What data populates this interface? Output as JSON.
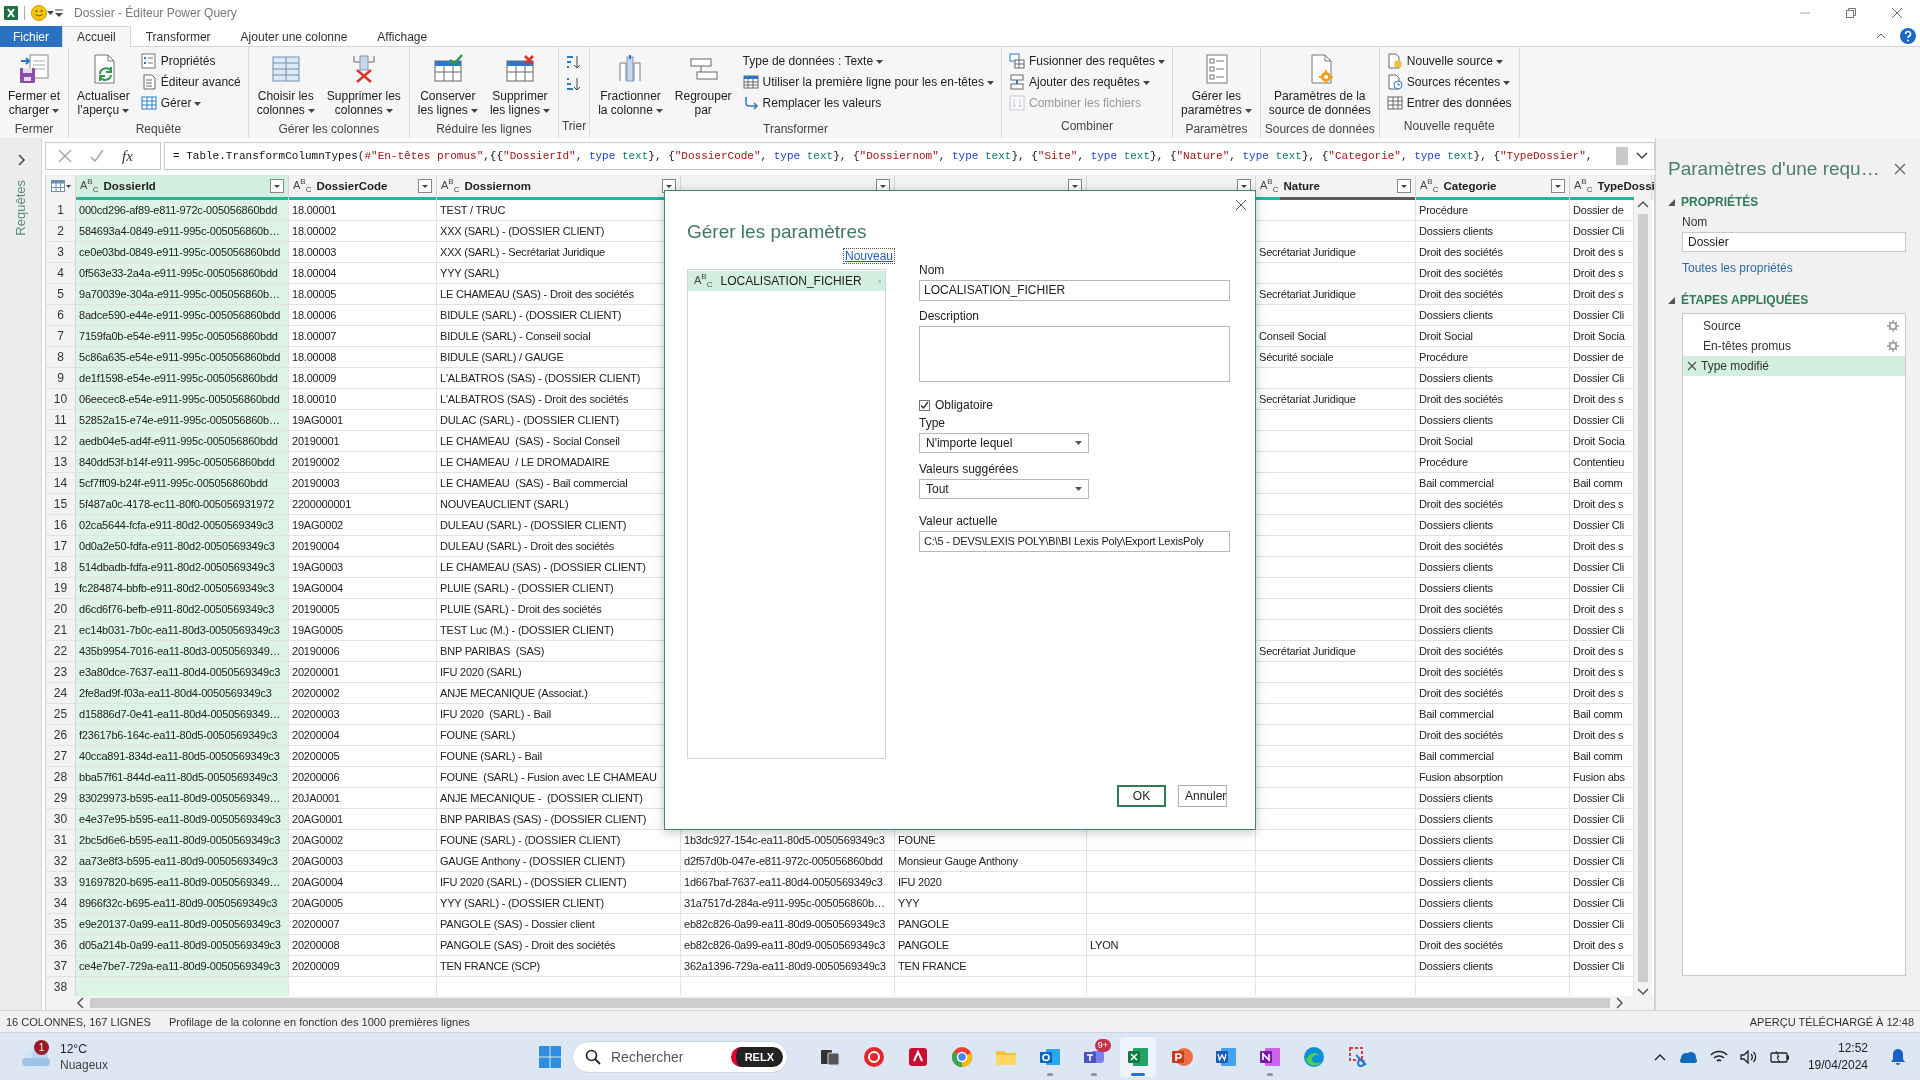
{
  "window": {
    "title": "Dossier - Éditeur Power Query"
  },
  "ribbon": {
    "tabs": [
      {
        "label": "Fichier",
        "kind": "file",
        "selected": false
      },
      {
        "label": "Accueil",
        "kind": "tab",
        "selected": true
      },
      {
        "label": "Transformer",
        "kind": "tab",
        "selected": false
      },
      {
        "label": "Ajouter une colonne",
        "kind": "tab",
        "selected": false
      },
      {
        "label": "Affichage",
        "kind": "tab",
        "selected": false
      }
    ],
    "groups": [
      {
        "label": "Fermer",
        "buttons": [
          {
            "kind": "large",
            "label": "Fermer et\ncharger",
            "dropdown": true,
            "disabled": false
          }
        ]
      },
      {
        "label": "Requête",
        "buttons": [
          {
            "kind": "large",
            "label": "Actualiser\nl'aperçu",
            "dropdown": true,
            "disabled": false
          },
          {
            "kind": "small",
            "label": "Propriétés",
            "dropdown": false,
            "disabled": false
          },
          {
            "kind": "small",
            "label": "Éditeur avancé",
            "dropdown": false,
            "disabled": false
          },
          {
            "kind": "small",
            "label": "Gérer",
            "dropdown": true,
            "disabled": false
          }
        ]
      },
      {
        "label": "Gérer les colonnes",
        "buttons": [
          {
            "kind": "large",
            "label": "Choisir les\ncolonnes",
            "dropdown": true,
            "disabled": false
          },
          {
            "kind": "large",
            "label": "Supprimer les\ncolonnes",
            "dropdown": true,
            "disabled": false
          }
        ]
      },
      {
        "label": "Réduire les lignes",
        "buttons": [
          {
            "kind": "large",
            "label": "Conserver\nles lignes",
            "dropdown": true,
            "disabled": false
          },
          {
            "kind": "large",
            "label": "Supprimer\nles lignes",
            "dropdown": true,
            "disabled": false
          }
        ]
      },
      {
        "label": "Trier",
        "buttons": [
          {
            "kind": "icon",
            "dropdown": false,
            "disabled": false
          },
          {
            "kind": "icon",
            "dropdown": false,
            "disabled": false
          }
        ]
      },
      {
        "label": "Transformer",
        "buttons": [
          {
            "kind": "large",
            "label": "Fractionner\nla colonne",
            "dropdown": true,
            "disabled": false
          },
          {
            "kind": "large",
            "label": "Regrouper\npar",
            "dropdown": false,
            "disabled": false
          },
          {
            "kind": "small",
            "label": "Type de données : Texte",
            "dropdown": true,
            "disabled": false
          },
          {
            "kind": "small",
            "label": "Utiliser la première ligne pour les en-têtes",
            "dropdown": true,
            "disabled": false
          },
          {
            "kind": "small",
            "label": "Remplacer les valeurs",
            "dropdown": false,
            "disabled": false
          }
        ]
      },
      {
        "label": "Combiner",
        "buttons": [
          {
            "kind": "small",
            "label": "Fusionner des requêtes",
            "dropdown": true,
            "disabled": false
          },
          {
            "kind": "small",
            "label": "Ajouter des requêtes",
            "dropdown": true,
            "disabled": false
          },
          {
            "kind": "small",
            "label": "Combiner les fichiers",
            "dropdown": false,
            "disabled": true
          }
        ]
      },
      {
        "label": "Paramètres",
        "buttons": [
          {
            "kind": "large",
            "label": "Gérer les\nparamètres",
            "dropdown": true,
            "disabled": false
          }
        ]
      },
      {
        "label": "Sources de données",
        "buttons": [
          {
            "kind": "large",
            "label": "Paramètres de la\nsource de données",
            "dropdown": false,
            "disabled": false
          }
        ]
      },
      {
        "label": "Nouvelle requête",
        "buttons": [
          {
            "kind": "small",
            "label": "Nouvelle source",
            "dropdown": true,
            "disabled": false
          },
          {
            "kind": "small",
            "label": "Sources récentes",
            "dropdown": true,
            "disabled": false
          },
          {
            "kind": "small",
            "label": "Entrer des données",
            "dropdown": false,
            "disabled": false
          }
        ]
      }
    ]
  },
  "queries_pane": {
    "label": "Requêtes",
    "expanded": false
  },
  "formula_bar": {
    "fx": "fx",
    "segments": [
      {
        "kind": "plain",
        "text": "= Table.TransformColumnTypes("
      },
      {
        "kind": "string",
        "text": "#\"En-têtes promus\""
      },
      {
        "kind": "plain",
        "text": ",{{"
      },
      {
        "kind": "string",
        "text": "\"DossierId\""
      },
      {
        "kind": "plain",
        "text": ", "
      },
      {
        "kind": "keyword",
        "text": "type"
      },
      {
        "kind": "type",
        "text": " text"
      },
      {
        "kind": "plain",
        "text": "}, {"
      },
      {
        "kind": "string",
        "text": "\"DossierCode\""
      },
      {
        "kind": "plain",
        "text": ", "
      },
      {
        "kind": "keyword",
        "text": "type"
      },
      {
        "kind": "type",
        "text": " text"
      },
      {
        "kind": "plain",
        "text": "}, {"
      },
      {
        "kind": "string",
        "text": "\"Dossiernom\""
      },
      {
        "kind": "plain",
        "text": ", "
      },
      {
        "kind": "keyword",
        "text": "type"
      },
      {
        "kind": "type",
        "text": " text"
      },
      {
        "kind": "plain",
        "text": "}, {"
      },
      {
        "kind": "string",
        "text": "\"Site\""
      },
      {
        "kind": "plain",
        "text": ", "
      },
      {
        "kind": "keyword",
        "text": "type"
      },
      {
        "kind": "type",
        "text": " text"
      },
      {
        "kind": "plain",
        "text": "}, {"
      },
      {
        "kind": "string",
        "text": "\"Nature\""
      },
      {
        "kind": "plain",
        "text": ", "
      },
      {
        "kind": "keyword",
        "text": "type"
      },
      {
        "kind": "type",
        "text": " text"
      },
      {
        "kind": "plain",
        "text": "}, {"
      },
      {
        "kind": "string",
        "text": "\"Categorie\""
      },
      {
        "kind": "plain",
        "text": ", "
      },
      {
        "kind": "keyword",
        "text": "type"
      },
      {
        "kind": "type",
        "text": " text"
      },
      {
        "kind": "plain",
        "text": "}, {"
      },
      {
        "kind": "string",
        "text": "\"TypeDossier\""
      },
      {
        "kind": "plain",
        "text": ","
      }
    ]
  },
  "table": {
    "columns": [
      {
        "label": "DossierId",
        "type_icon": "A$^{B}$$_{C}$",
        "filter": true,
        "selected": true,
        "level": 1
      },
      {
        "label": "DossierCode",
        "type_icon": "A$^{B}$$_{C}$",
        "filter": true,
        "selected": false,
        "level": 1
      },
      {
        "label": "Dossiernom",
        "type_icon": "A$^{B}$$_{C}$",
        "filter": true,
        "selected": false,
        "level": 1
      },
      {
        "filter": true,
        "selected": false
      },
      {
        "filter": true,
        "selected": false
      },
      {
        "filter": true,
        "selected": false
      },
      {
        "label": "Nature",
        "type_icon": "A$^{B}$$_{C}$",
        "filter": true,
        "selected": false,
        "level": 0.15
      },
      {
        "label": "Categorie",
        "type_icon": "A$^{B}$$_{C}$",
        "filter": true,
        "selected": false,
        "level": 1
      },
      {
        "label": "TypeDossi",
        "type_icon": "A$^{B}$$_{C}$",
        "filter": false,
        "selected": false,
        "level": 1
      }
    ],
    "rows": [
      {
        "number": "1",
        "dossier_id": "000cd296-af89-e811-972c-005056860bdd",
        "dossier_code": "18.00001",
        "dossiernom": "TEST / TRUC",
        "categorie": "Procédure",
        "type_dossier": "Dossier de"
      },
      {
        "number": "2",
        "dossier_id": "584693a4-0849-e911-995c-005056860b…",
        "dossier_code": "18.00002",
        "dossiernom": "XXX (SARL) - (DOSSIER CLIENT)",
        "categorie": "Dossiers clients",
        "type_dossier": "Dossier Cli"
      },
      {
        "number": "3",
        "dossier_id": "ce0e03bd-0849-e911-995c-005056860bdd",
        "dossier_code": "18.00003",
        "dossiernom": "XXX (SARL) - Secrétariat Juridique",
        "nature": "Secrétariat Juridique",
        "categorie": "Droit des sociétés",
        "type_dossier": "Droit des s"
      },
      {
        "number": "4",
        "dossier_id": "0f563e33-2a4a-e911-995c-005056860bdd",
        "dossier_code": "18.00004",
        "dossiernom": "YYY (SARL)",
        "categorie": "Droit des sociétés",
        "type_dossier": "Droit des s"
      },
      {
        "number": "5",
        "dossier_id": "9a70039e-304a-e911-995c-005056860b…",
        "dossier_code": "18.00005",
        "dossiernom": "LE CHAMEAU (SAS) - Droit des sociétés",
        "nature": "Secrétariat Juridique",
        "categorie": "Droit des sociétés",
        "type_dossier": "Droit des s"
      },
      {
        "number": "6",
        "dossier_id": "8adce590-e44e-e911-995c-005056860bdd",
        "dossier_code": "18.00006",
        "dossiernom": "BIDULE (SARL) - (DOSSIER CLIENT)",
        "categorie": "Dossiers clients",
        "type_dossier": "Dossier Cli"
      },
      {
        "number": "7",
        "dossier_id": "7159fa0b-e54e-e911-995c-005056860bdd",
        "dossier_code": "18.00007",
        "dossiernom": "BIDULE (SARL) - Conseil social",
        "nature": "Conseil Social",
        "categorie": "Droit Social",
        "type_dossier": "Droit Socia"
      },
      {
        "number": "8",
        "dossier_id": "5c86a635-e54e-e911-995c-005056860bdd",
        "dossier_code": "18.00008",
        "dossiernom": "BIDULE (SARL) / GAUGE",
        "nature": "Sécurité sociale",
        "categorie": "Procédure",
        "type_dossier": "Dossier de"
      },
      {
        "number": "9",
        "dossier_id": "de1f1598-e54e-e911-995c-005056860bdd",
        "dossier_code": "18.00009",
        "dossiernom": "L'ALBATROS (SAS) - (DOSSIER CLIENT)",
        "categorie": "Dossiers clients",
        "type_dossier": "Dossier Cli"
      },
      {
        "number": "10",
        "dossier_id": "06eecec8-e54e-e911-995c-005056860bdd",
        "dossier_code": "18.00010",
        "dossiernom": "L'ALBATROS (SAS) - Droit des sociétés",
        "nature": "Secrétariat Juridique",
        "categorie": "Droit des sociétés",
        "type_dossier": "Droit des s"
      },
      {
        "number": "11",
        "dossier_id": "52852a15-e74e-e911-995c-005056860b…",
        "dossier_code": "19AG0001",
        "dossiernom": "DULAC (SARL) - (DOSSIER CLIENT)",
        "categorie": "Dossiers clients",
        "type_dossier": "Dossier Cli"
      },
      {
        "number": "12",
        "dossier_id": "aedb04e5-ad4f-e911-995c-005056860bdd",
        "dossier_code": "20190001",
        "dossiernom": "LE CHAMEAU  (SAS) - Social Conseil",
        "categorie": "Droit Social",
        "type_dossier": "Droit Socia"
      },
      {
        "number": "13",
        "dossier_id": "840dd53f-b14f-e911-995c-005056860bdd",
        "dossier_code": "20190002",
        "dossiernom": "LE CHAMEAU  / LE DROMADAIRE",
        "categorie": "Procédure",
        "type_dossier": "Contentieu"
      },
      {
        "number": "14",
        "dossier_id": "5cf7ff09-b24f-e911-995c-005056860bdd",
        "dossier_code": "20190003",
        "dossiernom": "LE CHAMEAU  (SAS) - Bail commercial",
        "categorie": "Bail commercial",
        "type_dossier": "Bail comm"
      },
      {
        "number": "15",
        "dossier_id": "5f487a0c-4178-ec11-80f0-005056931972",
        "dossier_code": "2200000001",
        "dossiernom": "NOUVEAUCLIENT (SARL)",
        "categorie": "Droit des sociétés",
        "type_dossier": "Droit des s"
      },
      {
        "number": "16",
        "dossier_id": "02ca5644-fcfa-e911-80d2-0050569349c3",
        "dossier_code": "19AG0002",
        "dossiernom": "DULEAU (SARL) - (DOSSIER CLIENT)",
        "categorie": "Dossiers clients",
        "type_dossier": "Dossier Cli"
      },
      {
        "number": "17",
        "dossier_id": "0d0a2e50-fdfa-e911-80d2-0050569349c3",
        "dossier_code": "20190004",
        "dossiernom": "DULEAU (SARL) - Droit des sociétés",
        "categorie": "Droit des sociétés",
        "type_dossier": "Droit des s"
      },
      {
        "number": "18",
        "dossier_id": "514dbadb-fdfa-e911-80d2-0050569349c3",
        "dossier_code": "19AG0003",
        "dossiernom": "LE CHAMEAU (SAS) - (DOSSIER CLIENT)",
        "categorie": "Dossiers clients",
        "type_dossier": "Dossier Cli"
      },
      {
        "number": "19",
        "dossier_id": "fc284874-bbfb-e911-80d2-0050569349c3",
        "dossier_code": "19AG0004",
        "dossiernom": "PLUIE (SARL) - (DOSSIER CLIENT)",
        "categorie": "Dossiers clients",
        "type_dossier": "Dossier Cli"
      },
      {
        "number": "20",
        "dossier_id": "d6cd6f76-befb-e911-80d2-0050569349c3",
        "dossier_code": "20190005",
        "dossiernom": "PLUIE (SARL) - Droit des sociétés",
        "categorie": "Droit des sociétés",
        "type_dossier": "Droit des s"
      },
      {
        "number": "21",
        "dossier_id": "ec14b031-7b0c-ea11-80d3-0050569349c3",
        "dossier_code": "19AG0005",
        "dossiernom": "TEST Luc (M.) - (DOSSIER CLIENT)",
        "categorie": "Dossiers clients",
        "type_dossier": "Dossier Cli"
      },
      {
        "number": "22",
        "dossier_id": "435b9954-7016-ea11-80d3-0050569349…",
        "dossier_code": "20190006",
        "dossiernom": "BNP PARIBAS  (SAS)",
        "nature": "Secrétariat Juridique",
        "categorie": "Droit des sociétés",
        "type_dossier": "Droit des s"
      },
      {
        "number": "23",
        "dossier_id": "e3a80dce-7637-ea11-80d4-0050569349c3",
        "dossier_code": "20200001",
        "dossiernom": "IFU 2020 (SARL)",
        "categorie": "Droit des sociétés",
        "type_dossier": "Droit des s"
      },
      {
        "number": "24",
        "dossier_id": "2fe8ad9f-f03a-ea11-80d4-0050569349c3",
        "dossier_code": "20200002",
        "dossiernom": "ANJE MECANIQUE (Associat.)",
        "categorie": "Droit des sociétés",
        "type_dossier": "Droit des s"
      },
      {
        "number": "25",
        "dossier_id": "d15886d7-0e41-ea11-80d4-0050569349…",
        "dossier_code": "20200003",
        "dossiernom": "IFU 2020  (SARL) - Bail",
        "categorie": "Bail commercial",
        "type_dossier": "Bail comm"
      },
      {
        "number": "26",
        "dossier_id": "f23617b6-164c-ea11-80d5-0050569349c3",
        "dossier_code": "20200004",
        "dossiernom": "FOUNE (SARL)",
        "categorie": "Droit des sociétés",
        "type_dossier": "Droit des s"
      },
      {
        "number": "27",
        "dossier_id": "40cca891-834d-ea11-80d5-0050569349c3",
        "dossier_code": "20200005",
        "dossiernom": "FOUNE (SARL) - Bail",
        "categorie": "Bail commercial",
        "type_dossier": "Bail comm"
      },
      {
        "number": "28",
        "dossier_id": "bba57f61-844d-ea11-80d5-0050569349c3",
        "dossier_code": "20200006",
        "dossiernom": "FOUNE  (SARL) - Fusion avec LE CHAMEAU",
        "categorie": "Fusion absorption",
        "type_dossier": "Fusion abs"
      },
      {
        "number": "29",
        "dossier_id": "83029973-b595-ea11-80d9-0050569349…",
        "dossier_code": "20JA0001",
        "dossiernom": "ANJE MECANIQUE -  (DOSSIER CLIENT)",
        "categorie": "Dossiers clients",
        "type_dossier": "Dossier Cli"
      },
      {
        "number": "30",
        "dossier_id": "e4e37e95-b595-ea11-80d9-0050569349c3",
        "dossier_code": "20AG0001",
        "dossiernom": "BNP PARIBAS (SAS) - (DOSSIER CLIENT)",
        "categorie": "Dossiers clients",
        "type_dossier": "Dossier Cli"
      },
      {
        "number": "31",
        "dossier_id": "2bc5d6e6-b595-ea11-80d9-0050569349c3",
        "dossier_code": "20AG0002",
        "dossiernom": "FOUNE (SARL) - (DOSSIER CLIENT)",
        "column_4": "1b3dc927-154c-ea11-80d5-0050569349c3",
        "column_5": "FOUNE",
        "categorie": "Dossiers clients",
        "type_dossier": "Dossier Cli"
      },
      {
        "number": "32",
        "dossier_id": "aa73e8f3-b595-ea11-80d9-0050569349c3",
        "dossier_code": "20AG0003",
        "dossiernom": "GAUGE Anthony - (DOSSIER CLIENT)",
        "column_4": "d2f57d0b-047e-e811-972c-005056860bdd",
        "column_5": "Monsieur Gauge Anthony",
        "categorie": "Dossiers clients",
        "type_dossier": "Dossier Cli"
      },
      {
        "number": "33",
        "dossier_id": "91697820-b695-ea11-80d9-0050569349…",
        "dossier_code": "20AG0004",
        "dossiernom": "IFU 2020 (SARL) - (DOSSIER CLIENT)",
        "column_4": "1d667baf-7637-ea11-80d4-0050569349c3",
        "column_5": "IFU 2020",
        "categorie": "Dossiers clients",
        "type_dossier": "Dossier Cli"
      },
      {
        "number": "34",
        "dossier_id": "8966f32c-b695-ea11-80d9-0050569349c3",
        "dossier_code": "20AG0005",
        "dossiernom": "YYY (SARL) - (DOSSIER CLIENT)",
        "column_4": "31a7517d-284a-e911-995c-005056860b…",
        "column_5": "YYY",
        "categorie": "Dossiers clients",
        "type_dossier": "Dossier Cli"
      },
      {
        "number": "35",
        "dossier_id": "e9e20137-0a99-ea11-80d9-0050569349c3",
        "dossier_code": "20200007",
        "dossiernom": "PANGOLE (SAS) - Dossier client",
        "column_4": "eb82c826-0a99-ea11-80d9-0050569349c3",
        "column_5": "PANGOLE",
        "categorie": "Dossiers clients",
        "type_dossier": "Dossier Cli"
      },
      {
        "number": "36",
        "dossier_id": "d05a214b-0a99-ea11-80d9-0050569349c3",
        "dossier_code": "20200008",
        "dossiernom": "PANGOLE (SAS) - Droit des sociétés",
        "column_4": "eb82c826-0a99-ea11-80d9-0050569349c3",
        "column_5": "PANGOLE",
        "column_6": "LYON",
        "categorie": "Droit des sociétés",
        "type_dossier": "Droit des s"
      },
      {
        "number": "37",
        "dossier_id": "ce4e7be7-729a-ea11-80d9-0050569349c3",
        "dossier_code": "20200009",
        "dossiernom": "TEN FRANCE (SCP)",
        "column_4": "362a1396-729a-ea11-80d9-0050569349c3",
        "column_5": "TEN FRANCE",
        "categorie": "Dossiers clients",
        "type_dossier": "Dossier Cli"
      },
      {
        "number": "38"
      }
    ]
  },
  "dialog": {
    "title": "Gérer les paramètres",
    "new_link": "Nouveau",
    "parameters": [
      {
        "type_icon": "A$^{B}$$_{C}$",
        "name": "LOCALISATION_FICHIER",
        "selected": true
      }
    ],
    "name_label": "Nom",
    "name_value": "LOCALISATION_FICHIER",
    "description_label": "Description",
    "required": {
      "label": "Obligatoire",
      "checked": true
    },
    "type_label": "Type",
    "type_value": "N'importe lequel",
    "suggested_label": "Valeurs suggérées",
    "suggested_value": "Tout",
    "current_label": "Valeur actuelle",
    "current_value": "C:\\5 - DEVS\\LEXIS POLY\\BI\\BI Lexis Poly\\Export LexisPoly",
    "buttons": [
      {
        "label": "OK",
        "kind": "primary"
      },
      {
        "label": "Annuler",
        "kind": "secondary"
      }
    ]
  },
  "query_settings": {
    "title": "Paramètres d'une requ…",
    "properties": {
      "heading": "PROPRIÉTÉS",
      "expanded": true,
      "name_label": "Nom",
      "name_value": "Dossier",
      "link": "Toutes les propriétés"
    },
    "steps": {
      "heading": "ÉTAPES APPLIQUÉES",
      "expanded": true,
      "items": [
        {
          "label": "Source",
          "selected": false,
          "has_settings": true
        },
        {
          "label": "En-têtes promus",
          "selected": false,
          "has_settings": true
        },
        {
          "label": "Type modifié",
          "selected": true,
          "has_settings": false
        }
      ]
    }
  },
  "status_bar": {
    "left": [
      "16 COLONNES, 167 LIGNES",
      "Profilage de la colonne en fonction des 1000 premières lignes"
    ],
    "right": "APERÇU TÉLÉCHARGÉ À 12:48"
  },
  "taskbar": {
    "weather": {
      "badge": "1",
      "temperature": "12°C",
      "condition": "Nuageux"
    },
    "search": {
      "placeholder": "Rechercher",
      "highlight": "RELX"
    },
    "apps": [
      {
        "running": false,
        "active": false
      },
      {
        "running": false,
        "active": false
      },
      {
        "running": false,
        "active": false
      },
      {
        "running": false,
        "active": false
      },
      {
        "running": false,
        "active": false
      },
      {
        "running": true,
        "active": false
      },
      {
        "running": true,
        "active": false,
        "badge": "9+"
      },
      {
        "running": true,
        "active": true
      },
      {
        "running": false,
        "active": false
      },
      {
        "running": false,
        "active": false
      },
      {
        "running": true,
        "active": false
      },
      {
        "running": false,
        "active": false
      },
      {
        "running": false,
        "active": false
      }
    ],
    "time": "12:52",
    "date": "19/04/2024"
  }
}
